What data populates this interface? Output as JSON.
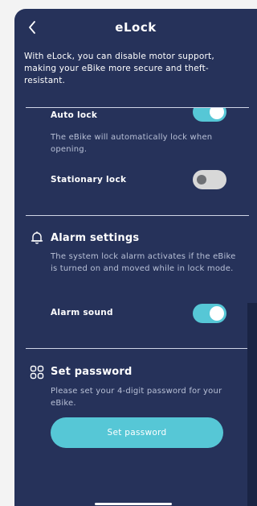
{
  "header": {
    "title": "eLock",
    "back_icon": "chevron-left-icon"
  },
  "intro": "With eLock, you can disable motor support, making your eBike more secure and theft-resistant.",
  "auto_lock": {
    "label": "Auto lock",
    "enabled": true,
    "description": "The eBike will automatically lock when opening."
  },
  "stationary_lock": {
    "label": "Stationary lock",
    "enabled": false
  },
  "alarm_settings": {
    "icon": "bell-icon",
    "title": "Alarm settings",
    "description": "The system lock alarm activates if the eBike is turned on and moved while in lock mode.",
    "alarm_sound_label": "Alarm sound",
    "alarm_sound_enabled": true
  },
  "password": {
    "icon": "keypad-grid-icon",
    "title": "Set password",
    "description": "Please set your 4-digit password for your eBike.",
    "button_label": "Set password"
  },
  "colors": {
    "background": "#26325a",
    "accent": "#56c7d6",
    "toggle_off": "#d8d8d8",
    "muted_text": "#b8c0d6"
  }
}
